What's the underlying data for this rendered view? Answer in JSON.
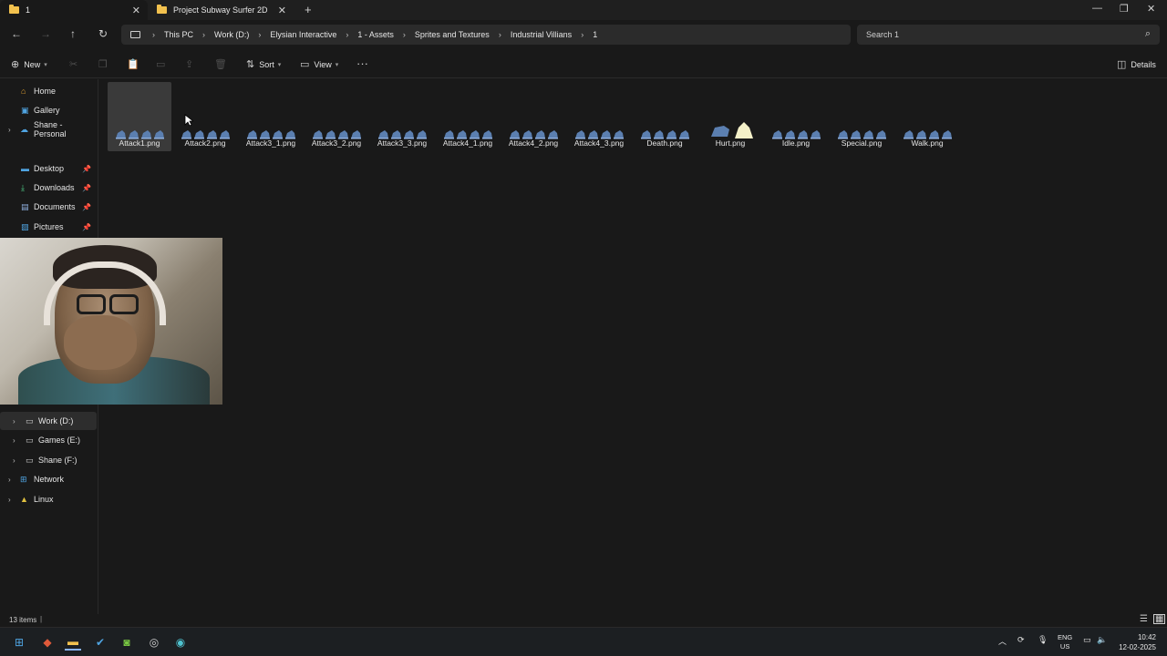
{
  "tabs": [
    {
      "label": "1",
      "active": true
    },
    {
      "label": "Project Subway Surfer 2D",
      "active": false
    }
  ],
  "breadcrumb": [
    "This PC",
    "Work (D:)",
    "Elysian Interactive",
    "1 - Assets",
    "Sprites and Textures",
    "Industrial Villians",
    "1"
  ],
  "search": {
    "placeholder": "Search 1"
  },
  "toolbar": {
    "new_label": "New",
    "sort_label": "Sort",
    "view_label": "View",
    "details_label": "Details"
  },
  "sidebar": {
    "home": "Home",
    "gallery": "Gallery",
    "personal": "Shane - Personal",
    "desktop": "Desktop",
    "downloads": "Downloads",
    "documents": "Documents",
    "pictures": "Pictures",
    "work": "Work (D:)",
    "games": "Games (E:)",
    "shane": "Shane (F:)",
    "network": "Network",
    "linux": "Linux"
  },
  "files": [
    "Attack1.png",
    "Attack2.png",
    "Attack3_1.png",
    "Attack3_2.png",
    "Attack3_3.png",
    "Attack4_1.png",
    "Attack4_2.png",
    "Attack4_3.png",
    "Death.png",
    "Hurt.png",
    "Idle.png",
    "Special.png",
    "Walk.png"
  ],
  "status": {
    "items": "13 items"
  },
  "tray": {
    "lang1": "ENG",
    "lang2": "US",
    "time": "10:42",
    "date": "12-02-2025"
  },
  "colors": {
    "accent": "#f2c14e",
    "sprite": "#5b7fb0",
    "background": "#191919"
  }
}
